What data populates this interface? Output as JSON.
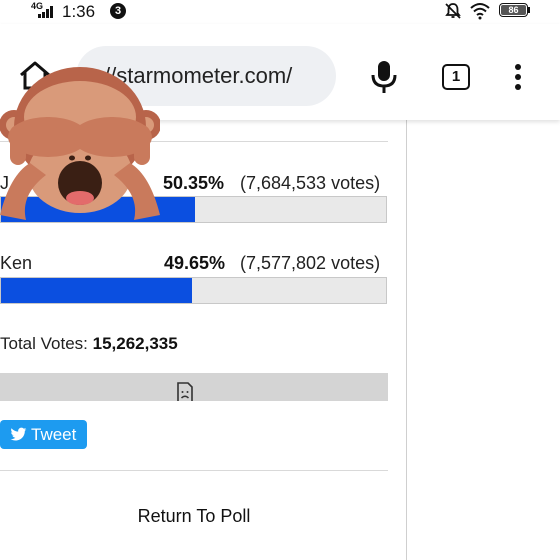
{
  "status_bar": {
    "network": "4G",
    "time": "1:36",
    "notification_count": "3",
    "battery": "86"
  },
  "browser": {
    "url": "//starmometer.com/",
    "tab_count": "1"
  },
  "poll": {
    "results": [
      {
        "name": "J",
        "percent": "50.35%",
        "votes": "(7,684,533 votes)",
        "fraction": 0.5035
      },
      {
        "name": "Ken",
        "percent": "49.65%",
        "votes": "(7,577,802 votes)",
        "fraction": 0.4965
      }
    ],
    "total_label": "Total Votes:",
    "total_value": "15,262,335",
    "tweet_label": "Tweet",
    "return_label": "Return To Poll"
  },
  "colors": {
    "bar_fill": "#0b4fe0",
    "tweet": "#1d9bf0"
  },
  "overlay": {
    "icon": "see-no-evil-monkey-emoji"
  }
}
